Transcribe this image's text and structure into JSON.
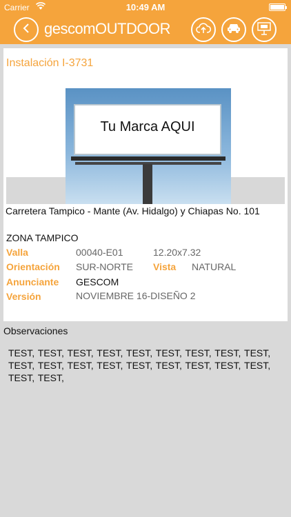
{
  "status_bar": {
    "carrier": "Carrier",
    "time": "10:49 AM"
  },
  "header": {
    "logo_part1": "gescom",
    "logo_part2": "OUTDOOR",
    "icons": [
      "back-icon",
      "cloud-upload-icon",
      "car-icon",
      "billboard-icon"
    ]
  },
  "installation": {
    "title": "Instalación I-3731",
    "billboard_text": "Tu Marca AQUI",
    "address": "Carretera Tampico - Mante (Av. Hidalgo) y Chiapas No. 101",
    "zone": "ZONA TAMPICO"
  },
  "details": {
    "valla_label": "Valla",
    "valla_value": "00040-E01",
    "size_value": "12.20x7.32",
    "orientacion_label": "Orientación",
    "orientacion_value": "SUR-NORTE",
    "vista_label": "Vista",
    "vista_value": "NATURAL",
    "anunciante_label": "Anunciante",
    "anunciante_value": "GESCOM",
    "version_label": "Versión",
    "version_value": "NOVIEMBRE 16-DISEÑO 2"
  },
  "observations": {
    "title": "Observaciones",
    "text": "TEST, TEST, TEST, TEST, TEST, TEST, TEST, TEST, TEST, TEST, TEST, TEST, TEST, TEST, TEST, TEST, TEST, TEST, TEST, TEST,"
  },
  "colors": {
    "accent": "#f5a43c",
    "background": "#d9d9d9",
    "card": "#ffffff"
  }
}
